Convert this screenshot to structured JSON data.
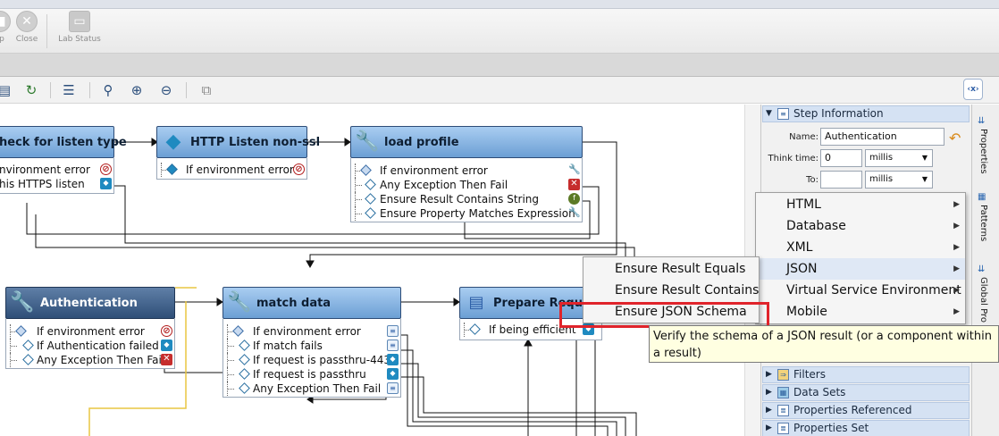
{
  "toolbar": {
    "stop_label": "p",
    "close_label": "Close",
    "lab_status_label": "Lab Status"
  },
  "canvas": {
    "nodes": [
      {
        "title": "heck for listen type",
        "assertions": [
          "nvironment error",
          "his HTTPS listen"
        ]
      },
      {
        "title": "HTTP Listen non-ssl",
        "assertions": [
          "If environment error"
        ]
      },
      {
        "title": "load profile",
        "assertions": [
          "If environment error",
          "Any Exception Then Fail",
          "Ensure Result Contains String",
          "Ensure Property Matches Expression"
        ]
      },
      {
        "title": "Authentication",
        "assertions": [
          "If environment error",
          "If Authentication failed",
          "Any Exception Then Fail"
        ]
      },
      {
        "title": "match data",
        "assertions": [
          "If environment error",
          "If match fails",
          "If request is passthru-443",
          "If request is passthru",
          "Any Exception Then Fail"
        ]
      },
      {
        "title": "Prepare Reque",
        "assertions": [
          "If being efficient"
        ]
      }
    ]
  },
  "right_panel": {
    "step_info_title": "Step Information",
    "name_label": "Name:",
    "name_value": "Authentication",
    "think_time_label": "Think time:",
    "think_time_value": "0",
    "think_time_unit": "millis",
    "to_label": "To:",
    "to_value": "",
    "to_unit": "millis",
    "sections": [
      "Filters",
      "Data Sets",
      "Properties Referenced",
      "Properties Set"
    ]
  },
  "side_tabs": [
    "Properties",
    "Patterns",
    "Global Pro"
  ],
  "context_menu": {
    "items": [
      "HTML",
      "Database",
      "XML",
      "JSON",
      "Virtual Service Environment",
      "Mobile"
    ],
    "active": "JSON"
  },
  "json_submenu": {
    "items": [
      "Ensure Result Equals",
      "Ensure Result Contains",
      "Ensure JSON Schema"
    ],
    "highlighted": "Ensure JSON Schema"
  },
  "tooltip": {
    "text": "Verify the schema of a JSON result (or a component within a result)"
  },
  "colors": {
    "node_header": "#8db9e6",
    "node_header_selected": "#3f6290",
    "highlight_box": "#e0242b",
    "tooltip_bg": "#ffffe1"
  }
}
